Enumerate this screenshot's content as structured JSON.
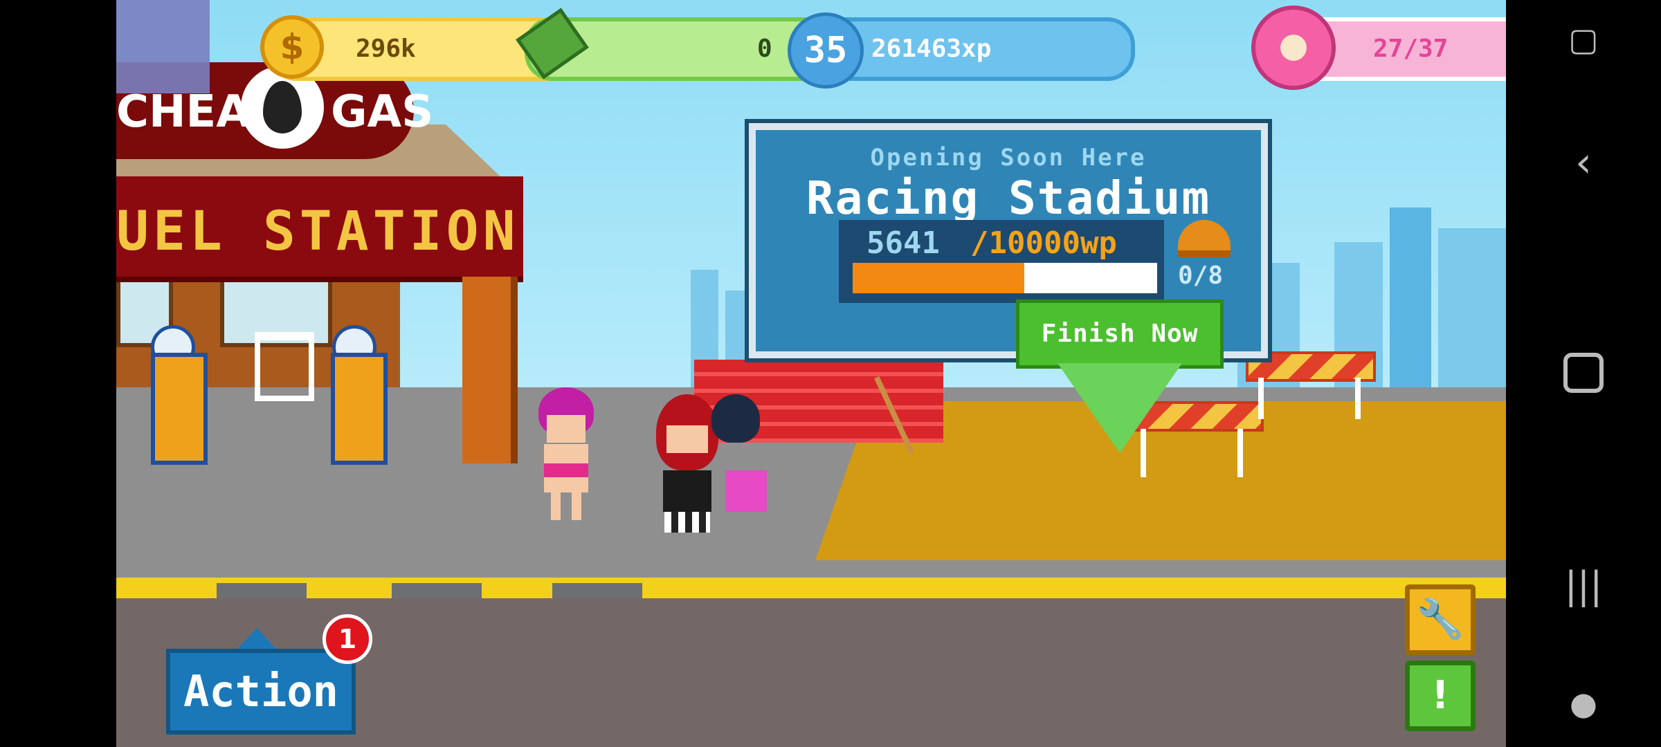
{
  "hud": {
    "coins": "296k",
    "cash": "0",
    "level": "35",
    "xp": "261463xp",
    "energy": "27/37",
    "plus": "+"
  },
  "gas_station": {
    "sign_left": "CHEAP",
    "sign_right": "GAS",
    "banner": "UEL STATION"
  },
  "billboard": {
    "subtitle": "Opening Soon Here",
    "title": "Racing Stadium",
    "progress_current": "5641",
    "progress_goal": "/10000wp",
    "progress_fraction": 0.564,
    "workers": "0/8",
    "finish_label": "Finish Now"
  },
  "action": {
    "label": "Action",
    "badge_count": "1"
  },
  "colors": {
    "coin_pill": "#fde57a",
    "cash_pill": "#b8ec90",
    "xp_pill": "#6ec2ee",
    "energy_pill": "#f7b4d6"
  },
  "icons": {
    "side_buttons": [
      "wrench-icon",
      "alert-icon"
    ],
    "nav": [
      "screen-icon",
      "back-icon",
      "home-icon",
      "recents-icon",
      "gamepad-icon"
    ]
  }
}
